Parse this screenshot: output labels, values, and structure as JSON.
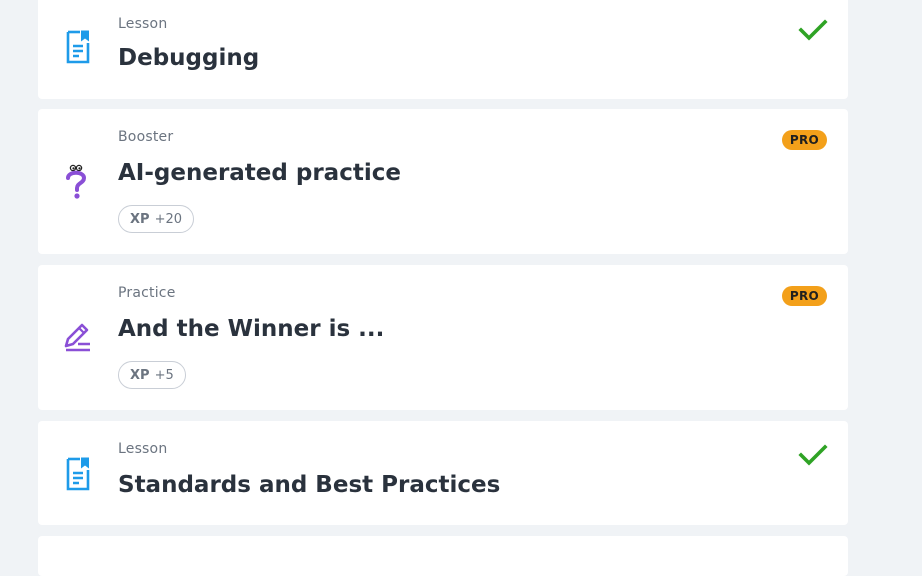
{
  "colors": {
    "background": "#f0f3f6",
    "lesson_icon": "#1e9be9",
    "booster_icon": "#8a4fd6",
    "practice_icon": "#8a4fd6",
    "pro_badge": "#f3a01a",
    "check": "#2fa325"
  },
  "items": [
    {
      "kind": "Lesson",
      "title": "Debugging",
      "icon": "lesson-doc-icon",
      "status": "completed"
    },
    {
      "kind": "Booster",
      "title": "AI-generated practice",
      "icon": "question-mark-icon",
      "badge": "PRO",
      "xp_label": "XP",
      "xp_value": "+20"
    },
    {
      "kind": "Practice",
      "title": "And the Winner is ...",
      "icon": "pencil-icon",
      "badge": "PRO",
      "xp_label": "XP",
      "xp_value": "+5"
    },
    {
      "kind": "Lesson",
      "title": "Standards and Best Practices",
      "icon": "lesson-doc-icon",
      "status": "completed"
    }
  ]
}
